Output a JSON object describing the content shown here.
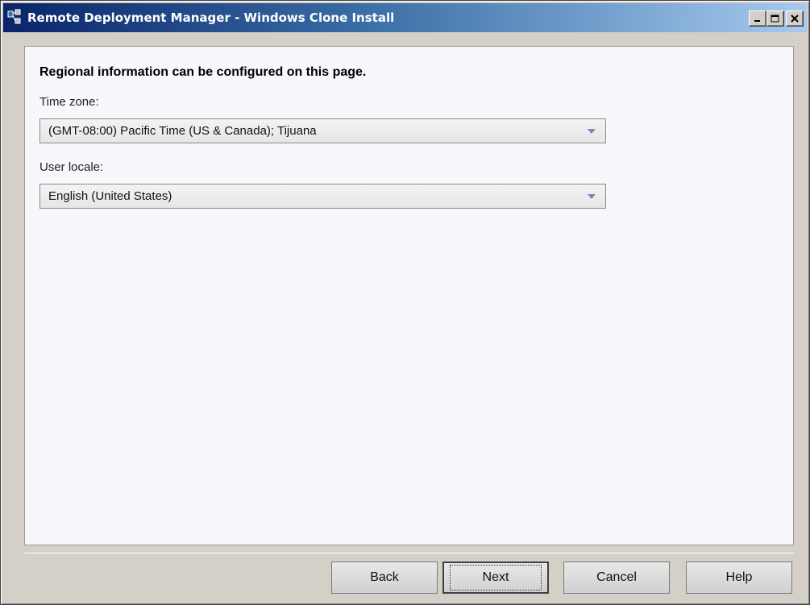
{
  "window": {
    "title": "Remote Deployment Manager - Windows Clone Install",
    "controls": {
      "minimize": "_",
      "maximize": "□",
      "close": "×"
    }
  },
  "icons": {
    "app": "rdm-app-icon",
    "combo_arrow": "chevron-down-icon"
  },
  "form": {
    "heading": "Regional information can be configured on this page.",
    "time_zone": {
      "label": "Time zone:",
      "value": "(GMT-08:00) Pacific Time (US & Canada); Tijuana"
    },
    "user_locale": {
      "label": "User locale:",
      "value": "English (United States)"
    }
  },
  "buttons": {
    "back": "Back",
    "next": "Next",
    "cancel": "Cancel",
    "help": "Help"
  },
  "colors": {
    "title_gradient_start": "#0a246a",
    "title_gradient_end": "#a6caf0",
    "dialog_bg": "#d4d0c8",
    "panel_bg": "#f8f8fc"
  }
}
